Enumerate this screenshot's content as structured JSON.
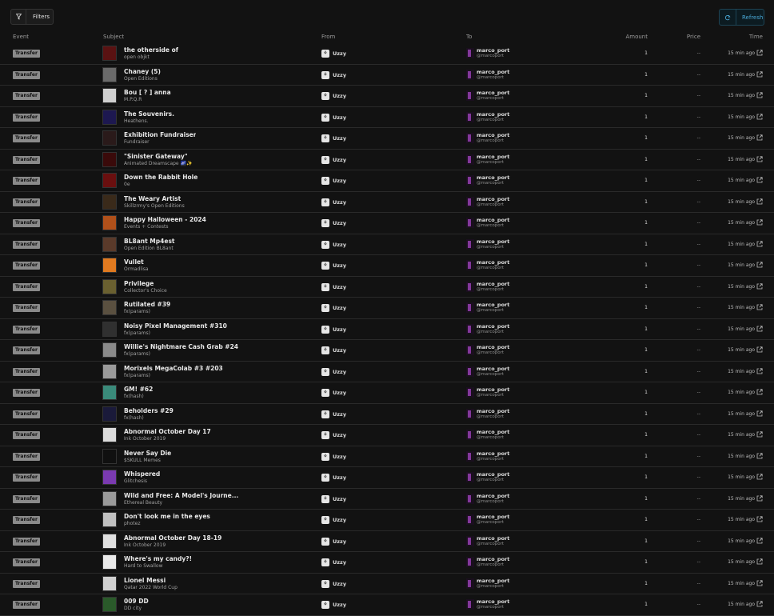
{
  "toolbar": {
    "filters_label": "Filters",
    "refresh_label": "Refresh",
    "filter_icon": "funnel-icon",
    "refresh_icon": "refresh-icon"
  },
  "columns": {
    "event": "Event",
    "subject": "Subject",
    "from": "From",
    "to": "To",
    "amount": "Amount",
    "price": "Price",
    "time": "Time"
  },
  "colors": {
    "background": "#121212",
    "accent": "#4aa8d6",
    "badge": "#8a8a8a"
  },
  "rows": [
    {
      "event": "Transfer",
      "title": "the otherside of",
      "collection": "open objkt",
      "from": "Uzzy",
      "to_name": "marco_port",
      "to_handle": "@marcoport",
      "amount": "1",
      "price": "--",
      "time": "15 min ago",
      "thumb": "#5a1212"
    },
    {
      "event": "Transfer",
      "title": "Chaney (5)",
      "collection": "Open Editions",
      "from": "Uzzy",
      "to_name": "marco_port",
      "to_handle": "@marcoport",
      "amount": "1",
      "price": "--",
      "time": "15 min ago",
      "thumb": "#6a6a6a"
    },
    {
      "event": "Transfer",
      "title": "Bou [ ? ] anna",
      "collection": "M.P.Q.R",
      "from": "Uzzy",
      "to_name": "marco_port",
      "to_handle": "@marcoport",
      "amount": "1",
      "price": "--",
      "time": "15 min ago",
      "thumb": "#cfcfcf"
    },
    {
      "event": "Transfer",
      "title": "The Souvenirs.",
      "collection": "Heathens.",
      "from": "Uzzy",
      "to_name": "marco_port",
      "to_handle": "@marcoport",
      "amount": "1",
      "price": "--",
      "time": "15 min ago",
      "thumb": "#1d1850"
    },
    {
      "event": "Transfer",
      "title": "Exhibition Fundraiser",
      "collection": "Fundraiser",
      "from": "Uzzy",
      "to_name": "marco_port",
      "to_handle": "@marcoport",
      "amount": "1",
      "price": "--",
      "time": "15 min ago",
      "thumb": "#2a1a1a"
    },
    {
      "event": "Transfer",
      "title": "\"Sinister Gateway\"",
      "collection": "Animated Dreamscape 🌌✨",
      "from": "Uzzy",
      "to_name": "marco_port",
      "to_handle": "@marcoport",
      "amount": "1",
      "price": "--",
      "time": "15 min ago",
      "thumb": "#3a0a0a"
    },
    {
      "event": "Transfer",
      "title": "Down the Rabbit Hole",
      "collection": "0e",
      "from": "Uzzy",
      "to_name": "marco_port",
      "to_handle": "@marcoport",
      "amount": "1",
      "price": "--",
      "time": "15 min ago",
      "thumb": "#6a0f0f"
    },
    {
      "event": "Transfer",
      "title": "The Weary Artist",
      "collection": "Skillzrmy's Open Editions",
      "from": "Uzzy",
      "to_name": "marco_port",
      "to_handle": "@marcoport",
      "amount": "1",
      "price": "--",
      "time": "15 min ago",
      "thumb": "#3a2a1a"
    },
    {
      "event": "Transfer",
      "title": "Happy Halloween - 2024",
      "collection": "Events + Contests",
      "from": "Uzzy",
      "to_name": "marco_port",
      "to_handle": "@marcoport",
      "amount": "1",
      "price": "--",
      "time": "15 min ago",
      "thumb": "#b0501a"
    },
    {
      "event": "Transfer",
      "title": "BL8ant Mp4est",
      "collection": "Open Edition BL8ant",
      "from": "Uzzy",
      "to_name": "marco_port",
      "to_handle": "@marcoport",
      "amount": "1",
      "price": "--",
      "time": "15 min ago",
      "thumb": "#5a3a2a"
    },
    {
      "event": "Transfer",
      "title": "Vullet",
      "collection": "Ormadlisa",
      "from": "Uzzy",
      "to_name": "marco_port",
      "to_handle": "@marcoport",
      "amount": "1",
      "price": "--",
      "time": "15 min ago",
      "thumb": "#e07a20"
    },
    {
      "event": "Transfer",
      "title": "Privilege",
      "collection": "Collector's Choice",
      "from": "Uzzy",
      "to_name": "marco_port",
      "to_handle": "@marcoport",
      "amount": "1",
      "price": "--",
      "time": "15 min ago",
      "thumb": "#6a6030"
    },
    {
      "event": "Transfer",
      "title": "Rutilated #39",
      "collection": "fx(params)",
      "from": "Uzzy",
      "to_name": "marco_port",
      "to_handle": "@marcoport",
      "amount": "1",
      "price": "--",
      "time": "15 min ago",
      "thumb": "#5a5040"
    },
    {
      "event": "Transfer",
      "title": "Noisy Pixel Management #310",
      "collection": "fx(params)",
      "from": "Uzzy",
      "to_name": "marco_port",
      "to_handle": "@marcoport",
      "amount": "1",
      "price": "--",
      "time": "15 min ago",
      "thumb": "#303030"
    },
    {
      "event": "Transfer",
      "title": "Willie's Nightmare Cash Grab #24",
      "collection": "fx(params)",
      "from": "Uzzy",
      "to_name": "marco_port",
      "to_handle": "@marcoport",
      "amount": "1",
      "price": "--",
      "time": "15 min ago",
      "thumb": "#8a8a8a"
    },
    {
      "event": "Transfer",
      "title": "Morixels MegaColab #3 #203",
      "collection": "fx(params)",
      "from": "Uzzy",
      "to_name": "marco_port",
      "to_handle": "@marcoport",
      "amount": "1",
      "price": "--",
      "time": "15 min ago",
      "thumb": "#9a9a9a"
    },
    {
      "event": "Transfer",
      "title": "GM! #62",
      "collection": "fx(hash)",
      "from": "Uzzy",
      "to_name": "marco_port",
      "to_handle": "@marcoport",
      "amount": "1",
      "price": "--",
      "time": "15 min ago",
      "thumb": "#3a8a7a"
    },
    {
      "event": "Transfer",
      "title": "Beholders #29",
      "collection": "fx(hash)",
      "from": "Uzzy",
      "to_name": "marco_port",
      "to_handle": "@marcoport",
      "amount": "1",
      "price": "--",
      "time": "15 min ago",
      "thumb": "#1a1a3a"
    },
    {
      "event": "Transfer",
      "title": "Abnormal October Day 17",
      "collection": "Ink October 2019",
      "from": "Uzzy",
      "to_name": "marco_port",
      "to_handle": "@marcoport",
      "amount": "1",
      "price": "--",
      "time": "15 min ago",
      "thumb": "#dcdcdc"
    },
    {
      "event": "Transfer",
      "title": "Never Say Die",
      "collection": "$SKULL Memes",
      "from": "Uzzy",
      "to_name": "marco_port",
      "to_handle": "@marcoport",
      "amount": "1",
      "price": "--",
      "time": "15 min ago",
      "thumb": "#101010"
    },
    {
      "event": "Transfer",
      "title": "Whispered",
      "collection": "Glitchesis",
      "from": "Uzzy",
      "to_name": "marco_port",
      "to_handle": "@marcoport",
      "amount": "1",
      "price": "--",
      "time": "15 min ago",
      "thumb": "#7a3ab0"
    },
    {
      "event": "Transfer",
      "title": "Wild and Free: A Model's Journe...",
      "collection": "Ethereal Beauty",
      "from": "Uzzy",
      "to_name": "marco_port",
      "to_handle": "@marcoport",
      "amount": "1",
      "price": "--",
      "time": "15 min ago",
      "thumb": "#9a9a9a"
    },
    {
      "event": "Transfer",
      "title": "Don't look me in the eyes",
      "collection": "photez",
      "from": "Uzzy",
      "to_name": "marco_port",
      "to_handle": "@marcoport",
      "amount": "1",
      "price": "--",
      "time": "15 min ago",
      "thumb": "#c0c0c0"
    },
    {
      "event": "Transfer",
      "title": "Abnormal October Day 18-19",
      "collection": "Ink October 2019",
      "from": "Uzzy",
      "to_name": "marco_port",
      "to_handle": "@marcoport",
      "amount": "1",
      "price": "--",
      "time": "15 min ago",
      "thumb": "#e0e0e0"
    },
    {
      "event": "Transfer",
      "title": "Where's my candy?!",
      "collection": "Hard to Swallow",
      "from": "Uzzy",
      "to_name": "marco_port",
      "to_handle": "@marcoport",
      "amount": "1",
      "price": "--",
      "time": "15 min ago",
      "thumb": "#eaeaea"
    },
    {
      "event": "Transfer",
      "title": "Lionel Messi",
      "collection": "Qatar 2022 World Cup",
      "from": "Uzzy",
      "to_name": "marco_port",
      "to_handle": "@marcoport",
      "amount": "1",
      "price": "--",
      "time": "15 min ago",
      "thumb": "#d0d0d0"
    },
    {
      "event": "Transfer",
      "title": "009 DD",
      "collection": "DD city",
      "from": "Uzzy",
      "to_name": "marco_port",
      "to_handle": "@marcoport",
      "amount": "1",
      "price": "--",
      "time": "15 min ago",
      "thumb": "#2a5a2a"
    }
  ]
}
